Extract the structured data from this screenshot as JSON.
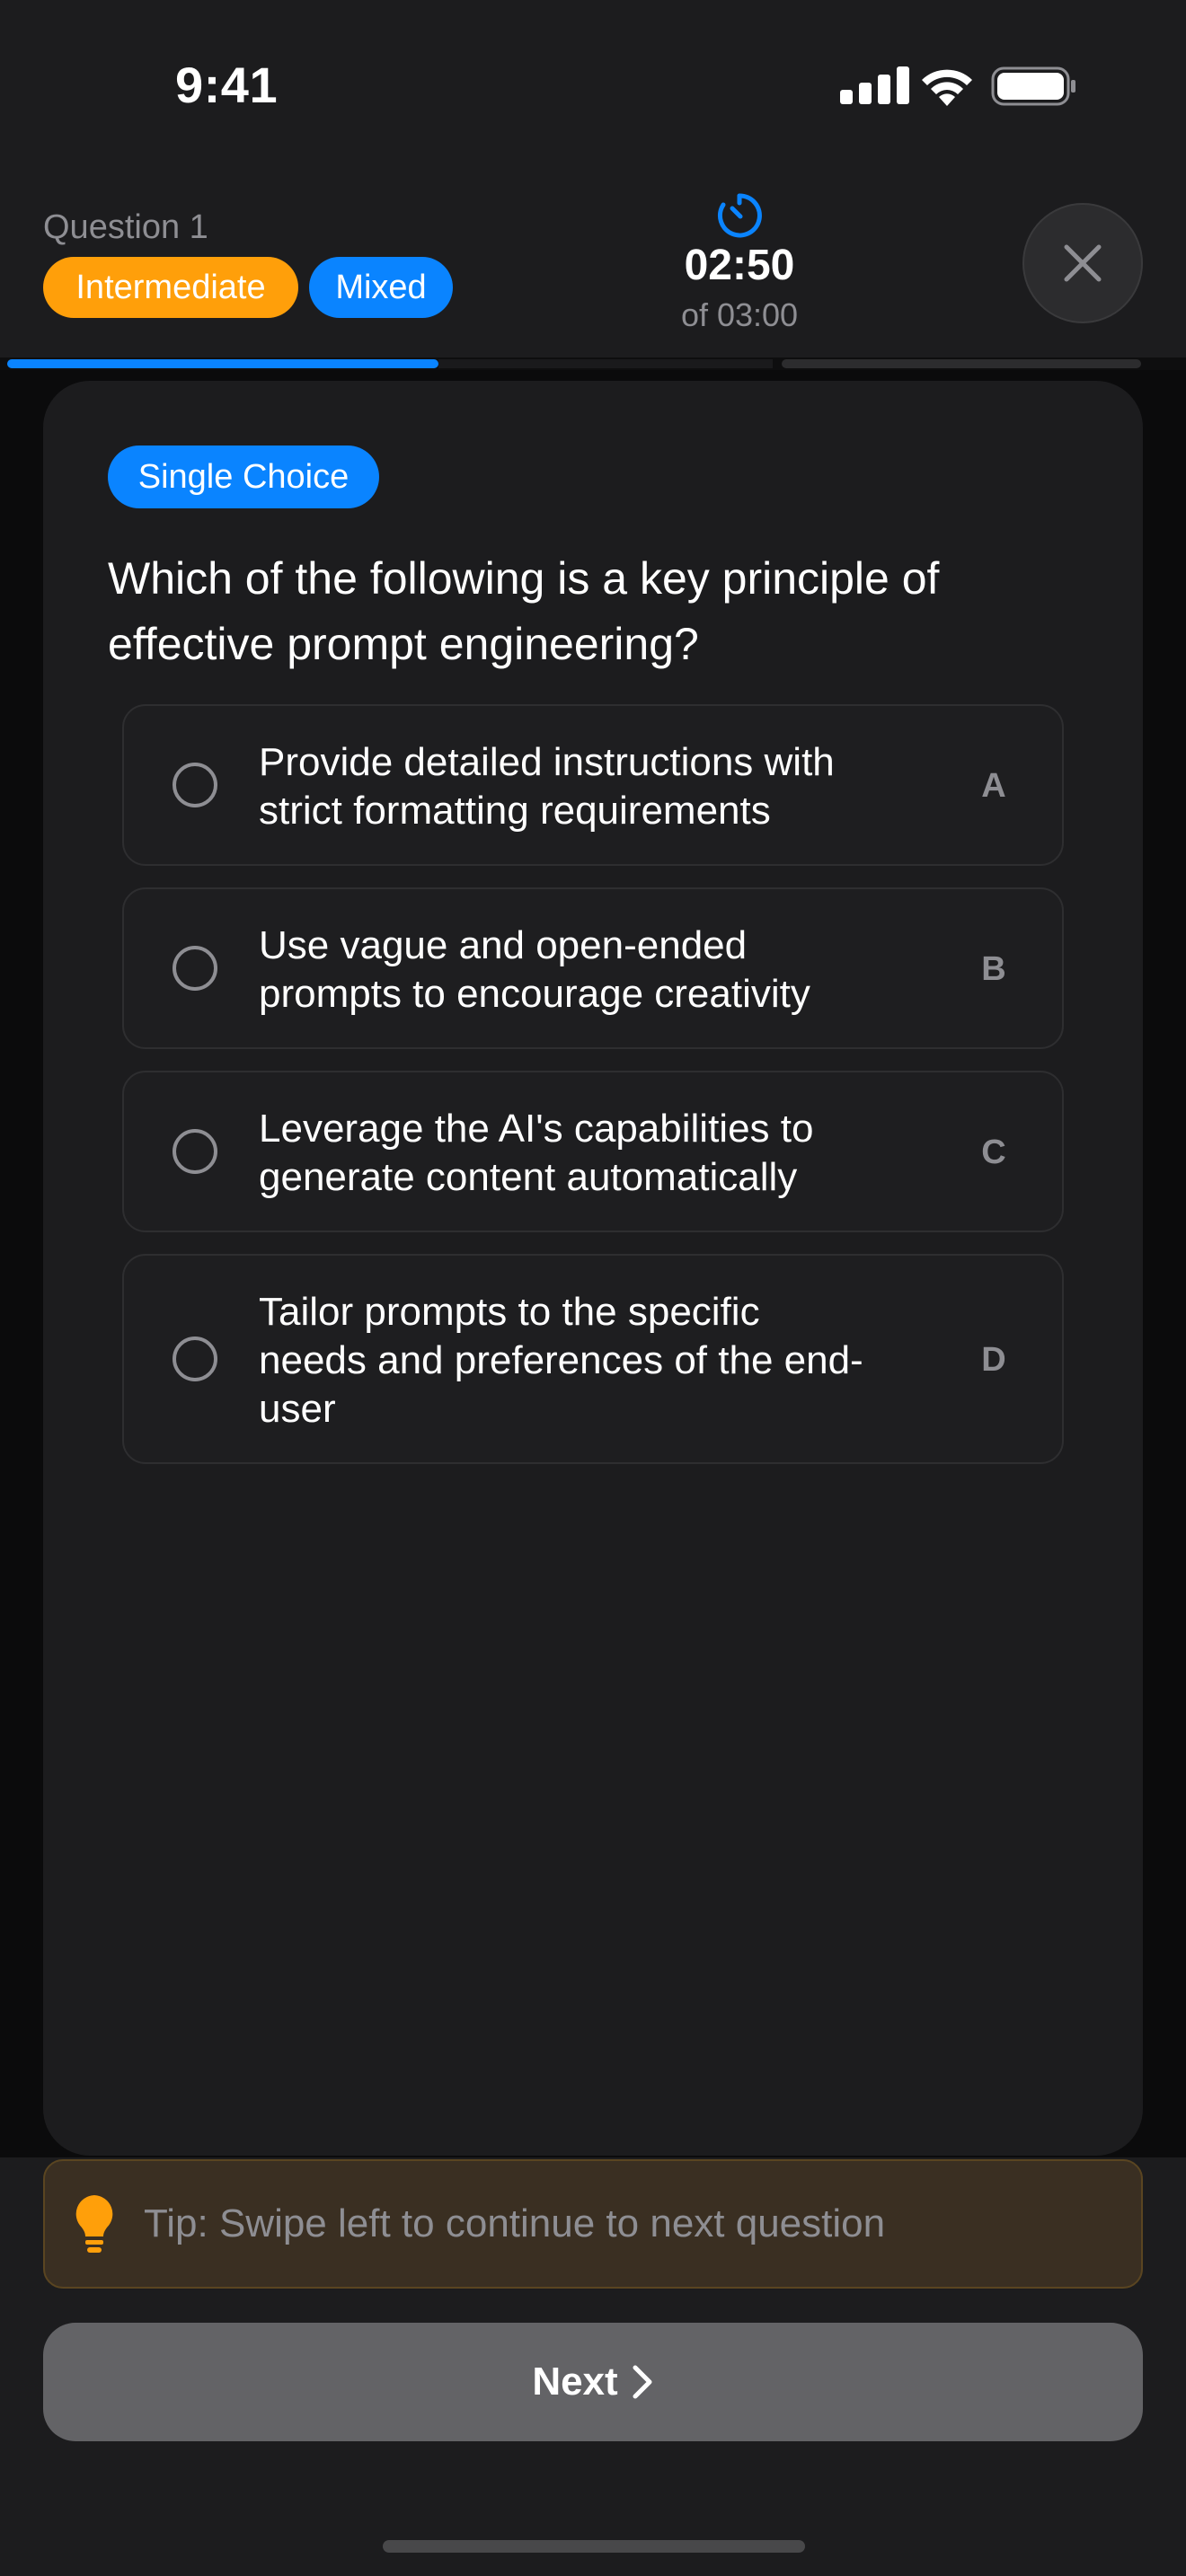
{
  "status_bar": {
    "time": "9:41"
  },
  "header": {
    "question_label": "Question 1",
    "level_badge": "Intermediate",
    "mode_badge": "Mixed",
    "timer_value": "02:50",
    "timer_total": "of 03:00"
  },
  "progress": {
    "current_segment_fraction": 0.56,
    "segments": 2
  },
  "question": {
    "type": "Single Choice",
    "text": "Which of the following is a key principle of effective prompt engineering?",
    "options": [
      {
        "letter": "A",
        "line1": "Provide detailed instructions with",
        "line2": "strict formatting requirements",
        "line3": ""
      },
      {
        "letter": "B",
        "line1": "Use vague and open-ended",
        "line2": "prompts to encourage creativity",
        "line3": ""
      },
      {
        "letter": "C",
        "line1": "Leverage the AI's capabilities to",
        "line2": "generate content automatically",
        "line3": ""
      },
      {
        "letter": "D",
        "line1": "Tailor prompts to the specific",
        "line2": "needs and preferences of the end-",
        "line3": "user"
      }
    ]
  },
  "tip": {
    "text": "Tip: Swipe left to continue to next question"
  },
  "footer": {
    "next_label": "Next"
  },
  "colors": {
    "accent": "#0a84ff",
    "level": "#ff9f0a",
    "background": "#1c1c1e",
    "next_button": "#636366"
  },
  "icons": [
    "signal-icon",
    "wifi-icon",
    "battery-icon",
    "timer-icon",
    "close-icon",
    "bulb-icon",
    "chevron-right-icon"
  ]
}
